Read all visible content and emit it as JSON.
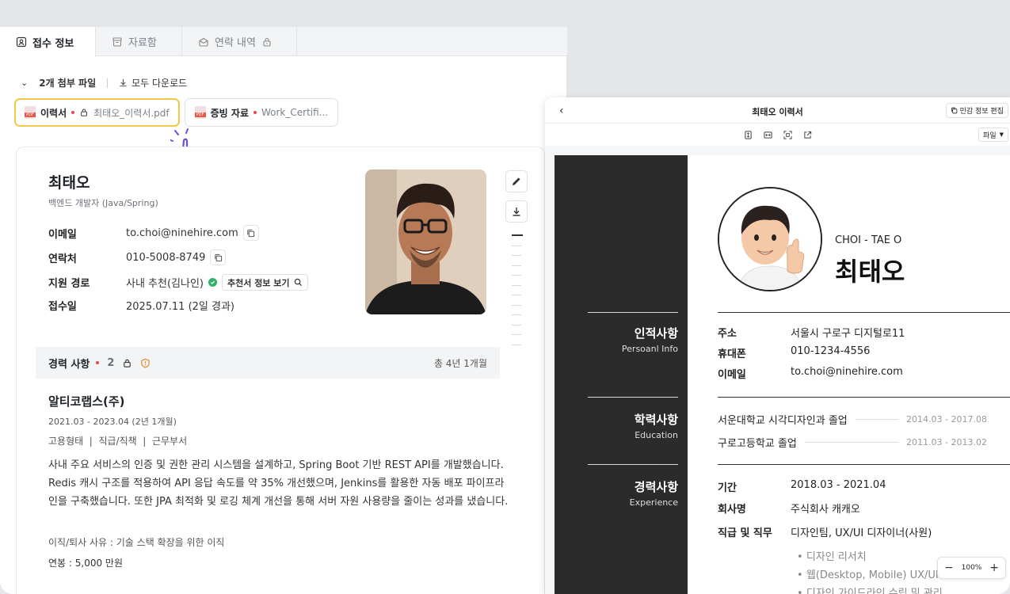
{
  "tabs": [
    {
      "label": "접수 정보",
      "icon": "person-card-icon",
      "active": true
    },
    {
      "label": "자료함",
      "icon": "archive-icon",
      "active": false
    },
    {
      "label": "연락 내역",
      "icon": "envelope-icon",
      "active": false
    }
  ],
  "attachments": {
    "count_label": "2개 첨부 파일",
    "download_all": "모두 다운로드",
    "files": [
      {
        "type": "이력서",
        "name": "최태오_이력서.pdf"
      },
      {
        "type": "증빙 자료",
        "name": "Work_Certifi..."
      }
    ]
  },
  "profile": {
    "name": "최태오",
    "role": "백엔드 개발자 (Java/Spring)",
    "fields": [
      {
        "label": "이메일",
        "value": "to.choi@ninehire.com"
      },
      {
        "label": "연락처",
        "value": "010-5008-8749"
      },
      {
        "label": "지원 경로",
        "value": "사내 추천(김나인)",
        "button": "추천서 정보 보기"
      },
      {
        "label": "접수일",
        "value": "2025.07.11 (2일 경과)"
      }
    ]
  },
  "career": {
    "title": "경력 사항",
    "count": "2",
    "total": "총 4년 1개월",
    "company": "알티코랩스(주)",
    "period": "2021.03 - 2023.04 (2년 1개월)",
    "meta": "고용형태  |  직급/직책  |  근무부서",
    "description": "사내 주요 서비스의 인증 및 권한 관리 시스템을 설계하고, Spring Boot 기반 REST API를 개발했습니다. Redis 캐시 구조를 적용하여 API 응답 속도를 약 35% 개선했으며, Jenkins를 활용한 자동 배포 파이프라인을 구축했습니다. 또한 JPA 최적화 및 로깅 체계 개선을 통해 서버 자원 사용량을 줄이는 성과를 냈습니다.",
    "reason": "이직/퇴사 사유 : 기술 스택 확장을 위한 이직",
    "salary": "연봉 : 5,000 만원"
  },
  "viewer": {
    "back": "‹",
    "title": "최태오 이력서",
    "edit_button": "민감 정보 편집",
    "file_select": "파일",
    "zoom": "100%",
    "zoom_minus": "−",
    "zoom_plus": "+"
  },
  "resume": {
    "english_name": "CHOI - TAE O",
    "korean_name": "최태오",
    "sections": [
      {
        "ko": "인적사항",
        "en": "Persoanl Info"
      },
      {
        "ko": "학력사항",
        "en": "Education"
      },
      {
        "ko": "경력사항",
        "en": "Experience"
      }
    ],
    "personal": [
      {
        "label": "주소",
        "value": "서울시 구로구 디지털로11"
      },
      {
        "label": "휴대폰",
        "value": "010-1234-4556"
      },
      {
        "label": "이메일",
        "value": "to.choi@ninehire.com"
      }
    ],
    "education": [
      {
        "school": "서운대학교 시각디자인과 졸업",
        "date": "2014.03 - 2017.08"
      },
      {
        "school": "구로고등학교 졸업",
        "date": "2011.03 - 2013.02"
      }
    ],
    "experience": [
      {
        "label": "기간",
        "value": "2018.03 - 2021.04"
      },
      {
        "label": "회사명",
        "value": "주식회사 캐캐오"
      },
      {
        "label": "직급 및 직무",
        "value": "디자인팀, UX/UI 디자이너(사원)"
      }
    ],
    "duties": [
      "디자인 리서치",
      "웹(Desktop, Mobile) UX/UI",
      "디자인 가이드라인 수립 및 관리"
    ]
  }
}
